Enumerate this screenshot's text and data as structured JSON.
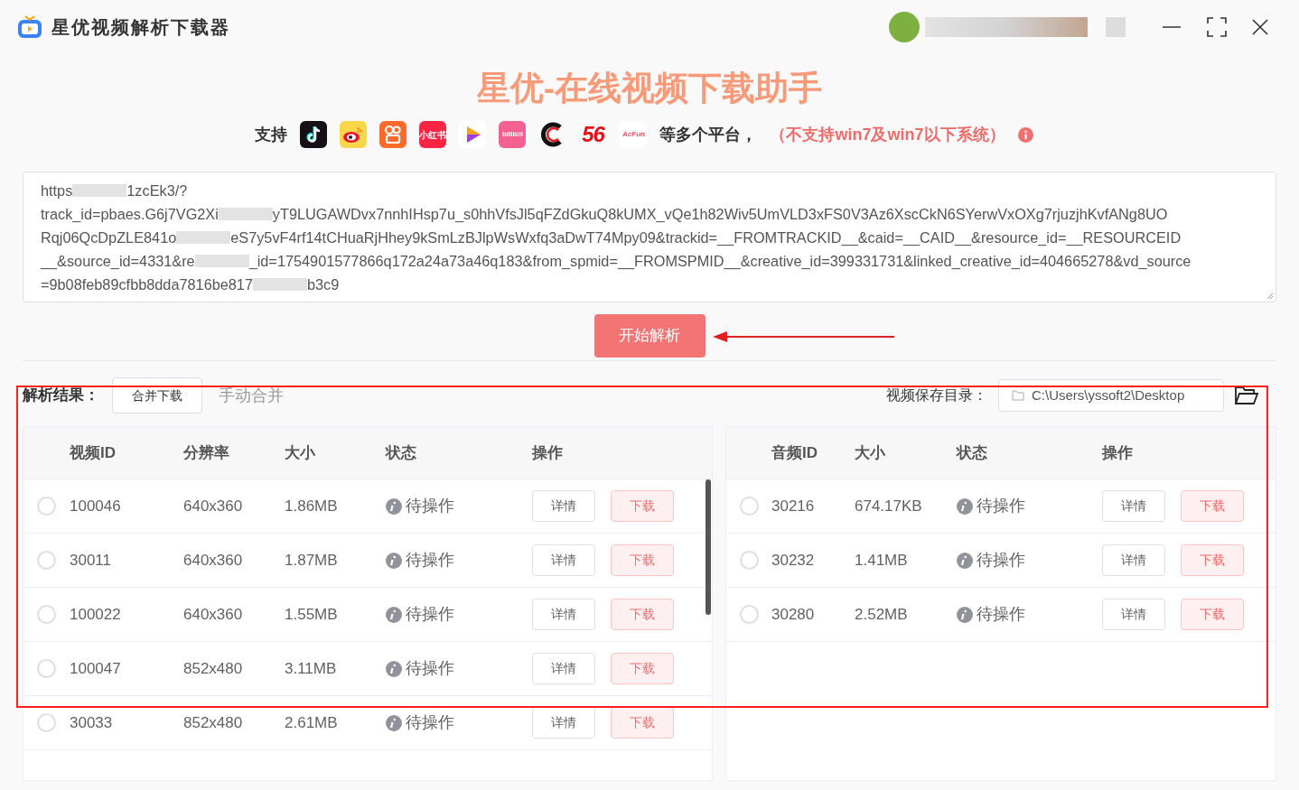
{
  "app": {
    "title": "星优视频解析下载器"
  },
  "window_controls": [
    {
      "kind": "minimize"
    },
    {
      "kind": "maximize"
    },
    {
      "kind": "close"
    }
  ],
  "headline": "星优-在线视频下载助手",
  "support": {
    "prefix": "支持",
    "platforms": [
      {
        "kind": "douyin"
      },
      {
        "kind": "weibo"
      },
      {
        "kind": "kuaishou"
      },
      {
        "kind": "xiaohongshu",
        "label": "小红书"
      },
      {
        "kind": "xigua"
      },
      {
        "kind": "bilibili",
        "label": "bilibili"
      },
      {
        "kind": "c"
      },
      {
        "kind": "wuliu",
        "label": "56"
      },
      {
        "kind": "acfun",
        "label": "AcFun"
      }
    ],
    "suffix": "等多个平台，",
    "note": "（不支持win7及win7以下系统）"
  },
  "url_input": {
    "lines": [
      [
        "https",
        "1zcEk3/?"
      ],
      [
        "track_id=pbaes.G6j7VG2Xi",
        "yT9LUGAWDvx7nnhIHsp7u_s0hhVfsJl5qFZdGkuQ8kUMX_vQe1h82Wiv5UmVLD3xFS0V3Az6XscCkN6SYerwVxOXg7rjuzjhKvfANg8UO"
      ],
      [
        "Rqj06QcDpZLE841o",
        "eS7y5vF4rf14tCHuaRjHhey9kSmLzBJlpWsWxfq3aDwT74Mpy09&trackid=__FROMTRACKID__&caid=__CAID__&resource_id=__RESOURCEID"
      ],
      [
        "__&source_id=4331&re",
        "_id=1754901577866q172a24a73a46q183&from_spmid=__FROMSPMID__&creative_id=399331731&linked_creative_id=404665278&vd_source"
      ],
      [
        "=9b08feb89cfbb8dda7816be817",
        "b3c9"
      ]
    ]
  },
  "parse_button": "开始解析",
  "results": {
    "label": "解析结果：",
    "merge_button": "合并下载",
    "manual_merge": "手动合并",
    "save_dir_label": "视频保存目录：",
    "save_dir": "C:\\Users\\yssoft2\\Desktop"
  },
  "video_table": {
    "columns": [
      "视频ID",
      "分辨率",
      "大小",
      "状态",
      "操作"
    ],
    "rows": [
      {
        "selected": false,
        "cells": [
          "100046",
          "640x360",
          "1.86MB"
        ],
        "status": "待操作",
        "actions": [
          "详情",
          "下载"
        ]
      },
      {
        "selected": false,
        "cells": [
          "30011",
          "640x360",
          "1.87MB"
        ],
        "status": "待操作",
        "actions": [
          "详情",
          "下载"
        ]
      },
      {
        "selected": false,
        "cells": [
          "100022",
          "640x360",
          "1.55MB"
        ],
        "status": "待操作",
        "actions": [
          "详情",
          "下载"
        ]
      },
      {
        "selected": false,
        "cells": [
          "100047",
          "852x480",
          "3.11MB"
        ],
        "status": "待操作",
        "actions": [
          "详情",
          "下载"
        ]
      },
      {
        "selected": false,
        "cells": [
          "30033",
          "852x480",
          "2.61MB"
        ],
        "status": "待操作",
        "actions": [
          "详情",
          "下载"
        ]
      }
    ]
  },
  "audio_table": {
    "columns": [
      "音频ID",
      "大小",
      "状态",
      "操作"
    ],
    "rows": [
      {
        "selected": false,
        "cells": [
          "30216",
          "674.17KB"
        ],
        "status": "待操作",
        "actions": [
          "详情",
          "下载"
        ]
      },
      {
        "selected": false,
        "cells": [
          "30232",
          "1.41MB"
        ],
        "status": "待操作",
        "actions": [
          "详情",
          "下载"
        ]
      },
      {
        "selected": false,
        "cells": [
          "30280",
          "2.52MB"
        ],
        "status": "待操作",
        "actions": [
          "详情",
          "下载"
        ]
      }
    ]
  }
}
